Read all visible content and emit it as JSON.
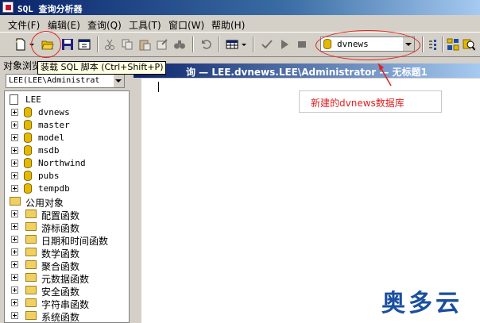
{
  "window": {
    "title": "SQL 查询分析器"
  },
  "menu": [
    "文件(F)",
    "编辑(E)",
    "查询(Q)",
    "工具(T)",
    "窗口(W)",
    "帮助(H)"
  ],
  "toolbar": {
    "database_selected": "dvnews",
    "tooltip": "装载 SQL 脚本 (Ctrl+Shift+P)"
  },
  "object_browser": {
    "title": "对象浏览器",
    "server_combo": "LEE(LEE\\Administrat",
    "server": "LEE",
    "databases": [
      "dvnews",
      "master",
      "model",
      "msdb",
      "Northwind",
      "pubs",
      "tempdb"
    ],
    "common_objects": "公用对象",
    "function_groups": [
      "配置函数",
      "游标函数",
      "日期和时间函数",
      "数学函数",
      "聚合函数",
      "元数据函数",
      "安全函数",
      "字符串函数",
      "系统函数"
    ]
  },
  "query_window": {
    "title": "询 — LEE.dvnews.LEE\\Administrator — 无标题1"
  },
  "annotation": {
    "text": "新建的dvnews数据库",
    "color": "#e0201e"
  },
  "watermark": "奥多云",
  "colors": {
    "title_bar": "#0a246a",
    "face": "#d4d0c8",
    "annotation": "#e0201e"
  }
}
